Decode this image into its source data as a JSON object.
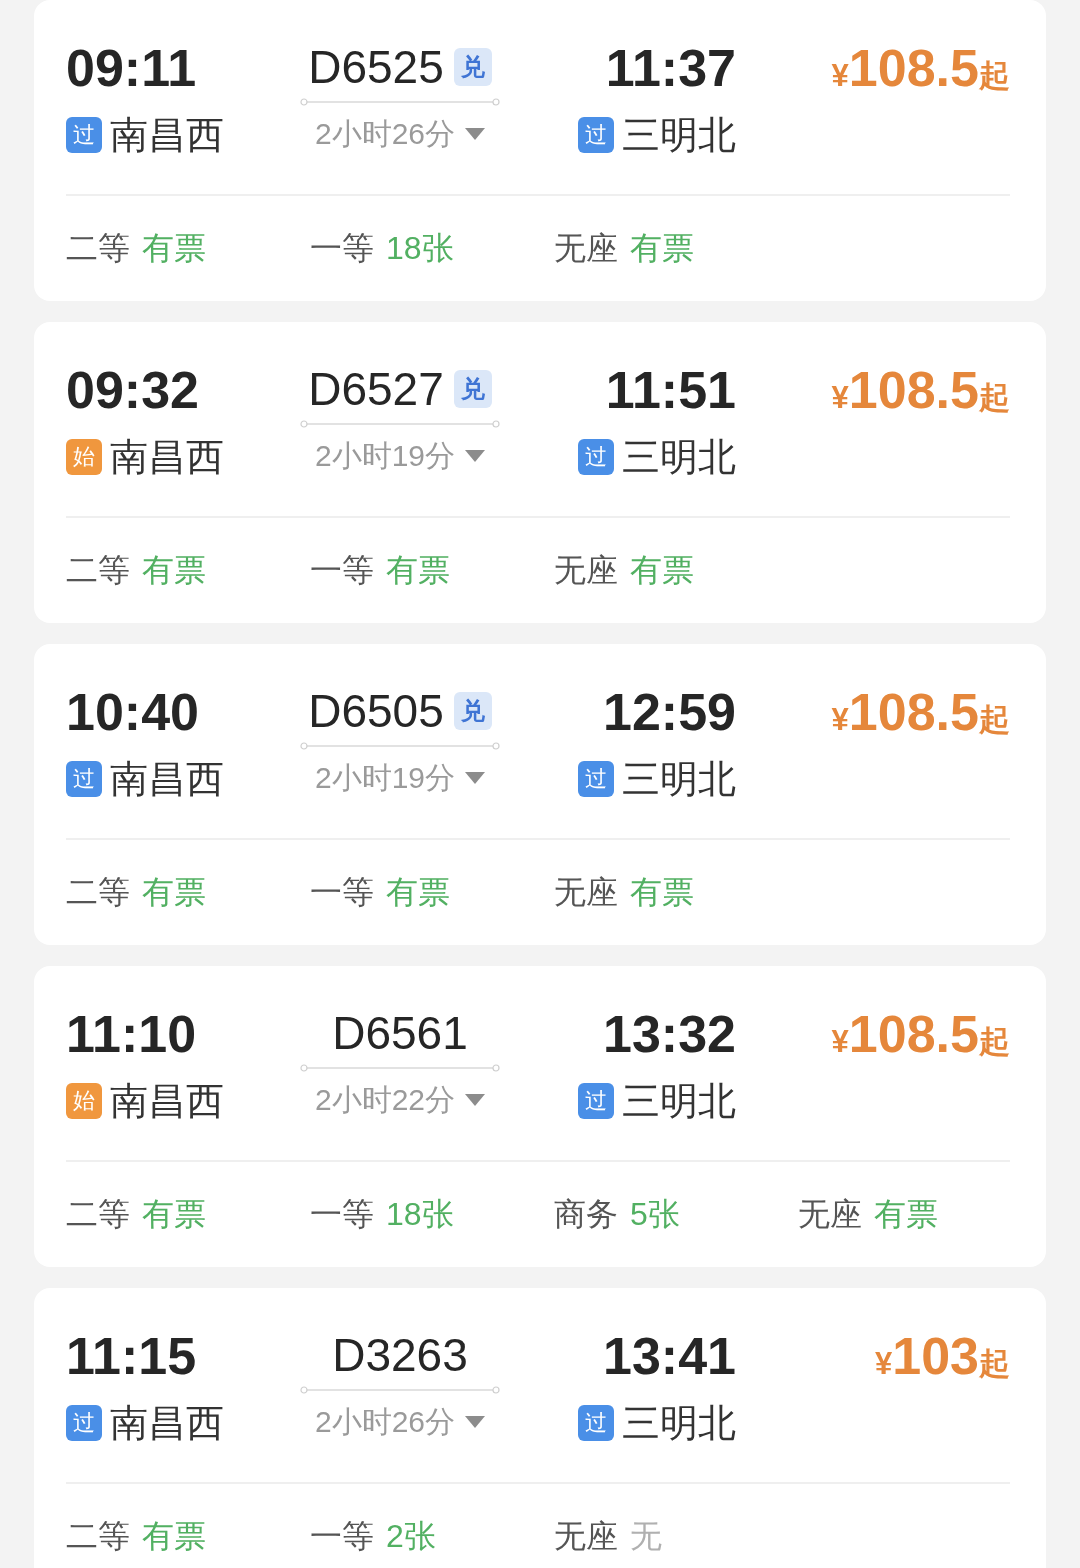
{
  "trains": [
    {
      "depart": {
        "time": "09:11",
        "badge": {
          "kind": "pass",
          "text": "过"
        },
        "station": "南昌西"
      },
      "train_no": "D6525",
      "tag": "兑",
      "duration": "2小时26分",
      "expanded": false,
      "arrive": {
        "time": "11:37",
        "badge": {
          "kind": "pass",
          "text": "过"
        },
        "station": "三明北"
      },
      "price": {
        "currency": "¥",
        "amount": "108.5",
        "suffix": "起"
      },
      "seats": [
        {
          "class": "二等",
          "status": "有票",
          "available": true
        },
        {
          "class": "一等",
          "status": "18张",
          "available": true
        },
        {
          "class": "无座",
          "status": "有票",
          "available": true
        }
      ]
    },
    {
      "depart": {
        "time": "09:32",
        "badge": {
          "kind": "start",
          "text": "始"
        },
        "station": "南昌西"
      },
      "train_no": "D6527",
      "tag": "兑",
      "duration": "2小时19分",
      "expanded": false,
      "arrive": {
        "time": "11:51",
        "badge": {
          "kind": "pass",
          "text": "过"
        },
        "station": "三明北"
      },
      "price": {
        "currency": "¥",
        "amount": "108.5",
        "suffix": "起"
      },
      "seats": [
        {
          "class": "二等",
          "status": "有票",
          "available": true
        },
        {
          "class": "一等",
          "status": "有票",
          "available": true
        },
        {
          "class": "无座",
          "status": "有票",
          "available": true
        }
      ]
    },
    {
      "depart": {
        "time": "10:40",
        "badge": {
          "kind": "pass",
          "text": "过"
        },
        "station": "南昌西"
      },
      "train_no": "D6505",
      "tag": "兑",
      "duration": "2小时19分",
      "expanded": false,
      "arrive": {
        "time": "12:59",
        "badge": {
          "kind": "pass",
          "text": "过"
        },
        "station": "三明北"
      },
      "price": {
        "currency": "¥",
        "amount": "108.5",
        "suffix": "起"
      },
      "seats": [
        {
          "class": "二等",
          "status": "有票",
          "available": true
        },
        {
          "class": "一等",
          "status": "有票",
          "available": true
        },
        {
          "class": "无座",
          "status": "有票",
          "available": true
        }
      ]
    },
    {
      "depart": {
        "time": "11:10",
        "badge": {
          "kind": "start",
          "text": "始"
        },
        "station": "南昌西"
      },
      "train_no": "D6561",
      "duration": "2小时22分",
      "expanded": false,
      "arrive": {
        "time": "13:32",
        "badge": {
          "kind": "pass",
          "text": "过"
        },
        "station": "三明北"
      },
      "price": {
        "currency": "¥",
        "amount": "108.5",
        "suffix": "起"
      },
      "seats": [
        {
          "class": "二等",
          "status": "有票",
          "available": true
        },
        {
          "class": "一等",
          "status": "18张",
          "available": true
        },
        {
          "class": "商务",
          "status": "5张",
          "available": true
        },
        {
          "class": "无座",
          "status": "有票",
          "available": true
        }
      ]
    },
    {
      "depart": {
        "time": "11:15",
        "badge": {
          "kind": "pass",
          "text": "过"
        },
        "station": "南昌西"
      },
      "train_no": "D3263",
      "duration": "2小时26分",
      "expanded": false,
      "arrive": {
        "time": "13:41",
        "badge": {
          "kind": "pass",
          "text": "过"
        },
        "station": "三明北"
      },
      "price": {
        "currency": "¥",
        "amount": "103",
        "suffix": "起"
      },
      "seats": [
        {
          "class": "二等",
          "status": "有票",
          "available": true
        },
        {
          "class": "一等",
          "status": "2张",
          "available": true
        },
        {
          "class": "无座",
          "status": "无",
          "available": false
        }
      ]
    }
  ]
}
